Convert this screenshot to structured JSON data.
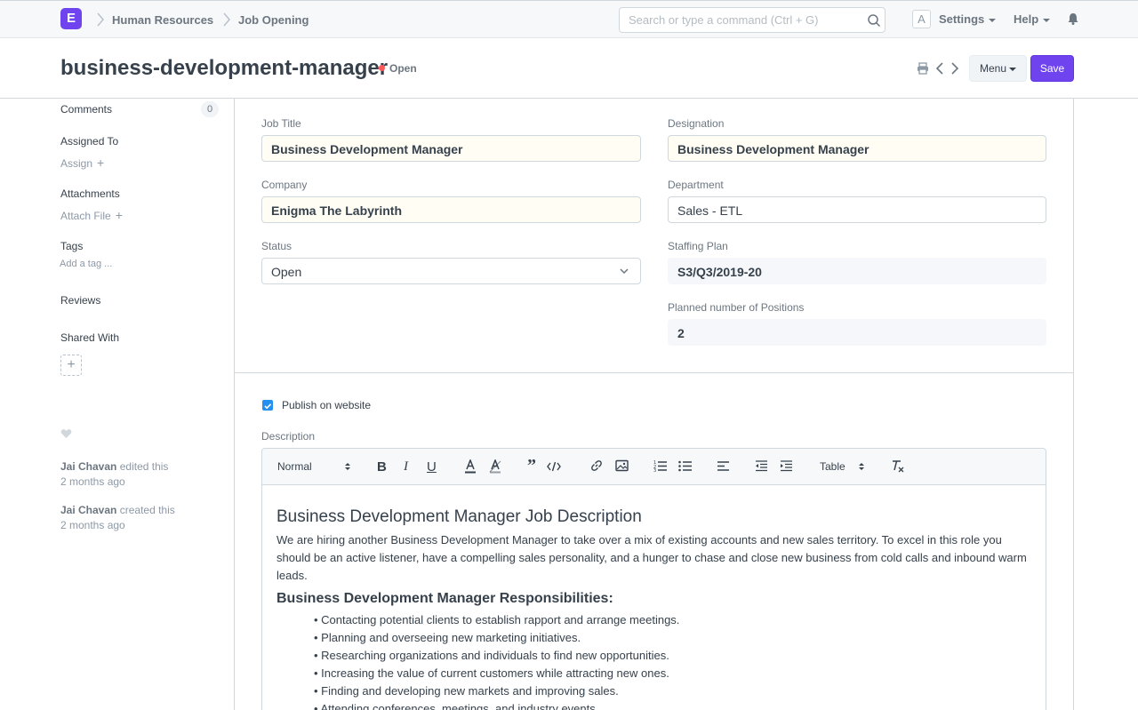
{
  "navbar": {
    "logo_letter": "E",
    "breadcrumbs": [
      "Human Resources",
      "Job Opening"
    ],
    "search_placeholder": "Search or type a command (Ctrl + G)",
    "avatar_letter": "A",
    "settings_label": "Settings",
    "help_label": "Help"
  },
  "page": {
    "title": "business-development-manager",
    "status": "Open",
    "status_color": "#ff5858",
    "menu_label": "Menu",
    "save_label": "Save",
    "accent_color": "#6f44ef"
  },
  "sidebar": {
    "comments_label": "Comments",
    "comments_count": "0",
    "assigned_to_label": "Assigned To",
    "assign_link": "Assign",
    "attachments_label": "Attachments",
    "attach_link": "Attach File",
    "tags_label": "Tags",
    "add_tag_link": "Add a tag ...",
    "reviews_label": "Reviews",
    "shared_with_label": "Shared With",
    "activity": [
      {
        "user": "Jai Chavan",
        "action": "edited this",
        "time": "2 months ago"
      },
      {
        "user": "Jai Chavan",
        "action": "created this",
        "time": "2 months ago"
      }
    ]
  },
  "form": {
    "job_title_label": "Job Title",
    "job_title_value": "Business Development Manager",
    "designation_label": "Designation",
    "designation_value": "Business Development Manager",
    "company_label": "Company",
    "company_value": "Enigma The Labyrinth",
    "department_label": "Department",
    "department_value": "Sales - ETL",
    "status_label": "Status",
    "status_value": "Open",
    "staffing_plan_label": "Staffing Plan",
    "staffing_plan_value": "S3/Q3/2019-20",
    "planned_positions_label": "Planned number of Positions",
    "planned_positions_value": "2",
    "publish_label": "Publish on website",
    "publish_checked": true,
    "description_label": "Description"
  },
  "editor": {
    "format_select": "Normal",
    "table_select": "Table",
    "heading": "Business Development Manager Job Description",
    "intro": "We are hiring another Business Development Manager to take over a mix of existing accounts and new sales territory. To excel in this role you should be an active listener, have a compelling sales personality, and a hunger to chase and close new business from cold calls and inbound warm leads.",
    "subheading": "Business Development Manager Responsibilities:",
    "bullets": [
      "Contacting potential clients to establish rapport and arrange meetings.",
      "Planning and overseeing new marketing initiatives.",
      "Researching organizations and individuals to find new opportunities.",
      "Increasing the value of current customers while attracting new ones.",
      "Finding and developing new markets and improving sales.",
      "Attending conferences, meetings, and industry events."
    ]
  }
}
